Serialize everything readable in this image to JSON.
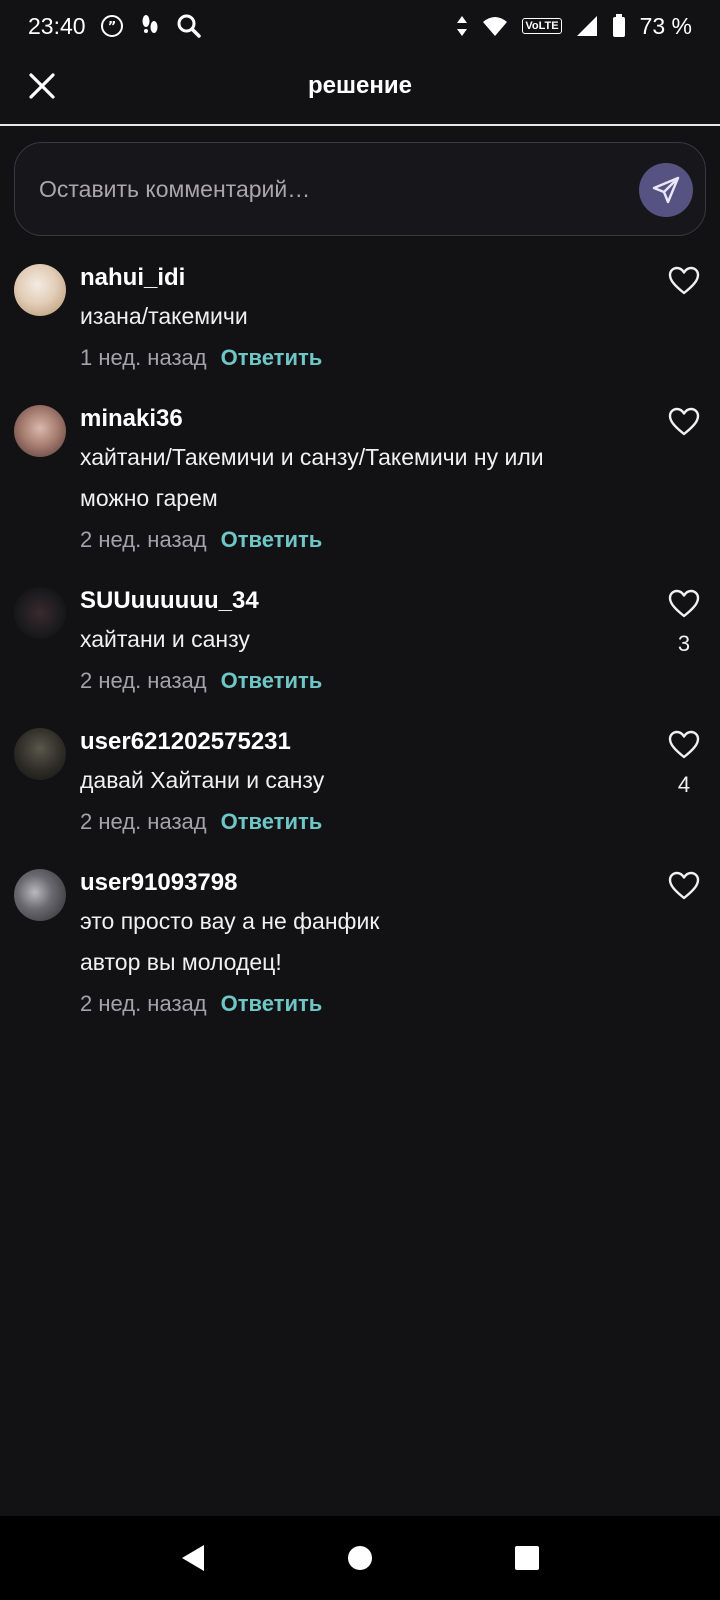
{
  "status_bar": {
    "time": "23:40",
    "battery": "73 %",
    "icons": [
      "quote-icon",
      "footsteps-icon",
      "search-icon",
      "data-arrows-icon",
      "wifi-icon",
      "volte-icon",
      "signal-icon",
      "battery-icon"
    ],
    "volte_label": "VoLTE"
  },
  "header": {
    "title": "решение",
    "close_icon": "close-icon"
  },
  "comment_input": {
    "placeholder": "Оставить комментарий…",
    "send_icon": "send-icon",
    "send_color": "#565281"
  },
  "colors": {
    "background": "#121114",
    "reply_accent": "#6ec6c6",
    "muted": "#a4a3a8"
  },
  "comments": [
    {
      "username": "nahui_idi",
      "lines": [
        "изана/такемичи"
      ],
      "time": "1 нед. назад",
      "reply": "Ответить",
      "likes": "",
      "avatar_colors": [
        "#e9dcd0",
        "#c9b08a"
      ]
    },
    {
      "username": "minaki36",
      "lines": [
        "хайтани/Такемичи и санзу/Такемичи ну или",
        "можно гарем"
      ],
      "time": "2 нед. назад",
      "reply": "Ответить",
      "likes": "",
      "avatar_colors": [
        "#c9a79a",
        "#6d4b46"
      ]
    },
    {
      "username": "SUUuuuuuu_34",
      "lines": [
        "хайтани и санзу"
      ],
      "time": "2 нед. назад",
      "reply": "Ответить",
      "likes": "3",
      "avatar_colors": [
        "#1c1c1f",
        "#7a2a35"
      ]
    },
    {
      "username": "user621202575231",
      "lines": [
        "давай Хайтани и санзу"
      ],
      "time": "2 нед. назад",
      "reply": "Ответить",
      "likes": "4",
      "avatar_colors": [
        "#3a3a30",
        "#1c1b19"
      ]
    },
    {
      "username": "user91093798",
      "lines": [
        "это просто вау а не фанфик",
        "автор вы молодец!"
      ],
      "time": "2 нед. назад",
      "reply": "Ответить",
      "likes": "",
      "avatar_colors": [
        "#9a9aa0",
        "#2b2a2e"
      ]
    }
  ],
  "nav_bar": {
    "icons": [
      "back-triangle-icon",
      "home-circle-icon",
      "recents-square-icon"
    ]
  }
}
